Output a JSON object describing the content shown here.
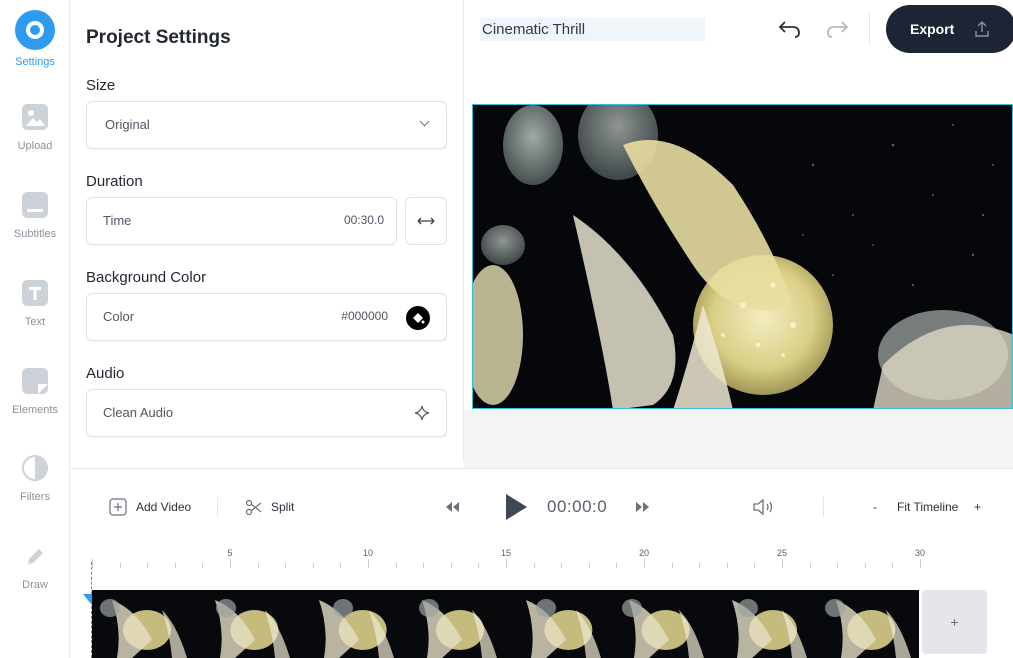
{
  "sidebar": {
    "items": [
      {
        "label": "Settings",
        "icon": "settings-icon",
        "active": true
      },
      {
        "label": "Upload",
        "icon": "image-upload-icon"
      },
      {
        "label": "Subtitles",
        "icon": "subtitles-icon"
      },
      {
        "label": "Text",
        "icon": "text-icon"
      },
      {
        "label": "Elements",
        "icon": "sticker-icon"
      },
      {
        "label": "Filters",
        "icon": "half-circle-icon"
      },
      {
        "label": "Draw",
        "icon": "pencil-icon"
      }
    ]
  },
  "settings": {
    "title": "Project Settings",
    "size": {
      "label": "Size",
      "value": "Original"
    },
    "duration": {
      "label": "Duration",
      "field_label": "Time",
      "value": "00:30.0"
    },
    "background": {
      "label": "Background Color",
      "field_label": "Color",
      "value": "#000000"
    },
    "audio": {
      "label": "Audio",
      "button_label": "Clean Audio"
    }
  },
  "topbar": {
    "project_title": "Cinematic Thrill",
    "export_label": "Export"
  },
  "timeline": {
    "add_video_label": "Add Video",
    "split_label": "Split",
    "current_time": "00:00:0",
    "zoom_out": "-",
    "fit_label": "Fit Timeline",
    "zoom_in": "+",
    "ruler_labels": [
      "5",
      "10",
      "15",
      "20",
      "25",
      "30"
    ],
    "add_clip_label": "+"
  },
  "colors": {
    "accent": "#2d9cf0",
    "export_bg": "#1d2433",
    "preview_border": "#33c2d8"
  }
}
